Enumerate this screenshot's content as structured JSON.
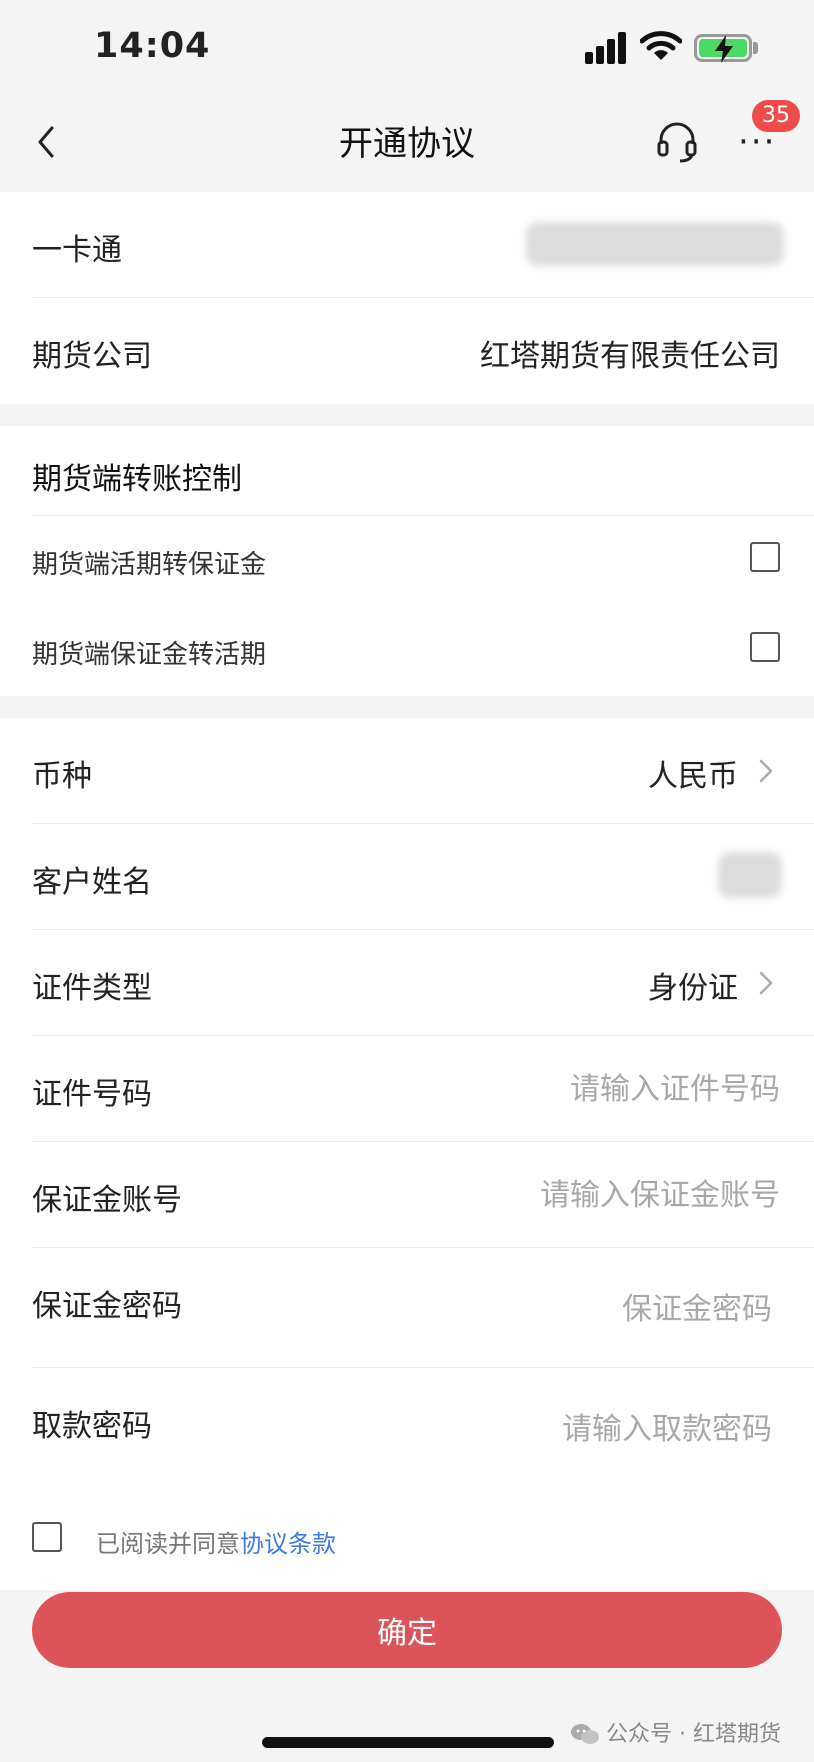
{
  "status_bar": {
    "time": "14:04"
  },
  "nav": {
    "title": "开通协议",
    "badge_count": "35",
    "icons": [
      "chevron-left-icon",
      "headset-icon",
      "more-icon"
    ]
  },
  "account": {
    "card_label": "一卡通",
    "company_label": "期货公司",
    "company_value": "红塔期货有限责任公司"
  },
  "transfer_control": {
    "title": "期货端转账控制",
    "options": [
      {
        "label": "期货端活期转保证金",
        "checked": false
      },
      {
        "label": "期货端保证金转活期",
        "checked": false
      }
    ]
  },
  "form": {
    "currency_label": "币种",
    "currency_value": "人民币",
    "name_label": "客户姓名",
    "id_type_label": "证件类型",
    "id_type_value": "身份证",
    "id_number_label": "证件号码",
    "id_number_placeholder": "请输入证件号码",
    "margin_account_label": "保证金账号",
    "margin_account_placeholder": "请输入保证金账号",
    "margin_password_label": "保证金密码",
    "margin_password_placeholder": "保证金密码",
    "withdraw_password_label": "取款密码",
    "withdraw_password_placeholder": "请输入取款密码"
  },
  "agreement": {
    "text": "已阅读并同意",
    "link": "协议条款",
    "checked": false
  },
  "confirm_label": "确定",
  "watermark": "公众号 · 红塔期货",
  "colors": {
    "accent": "#dc5459",
    "link": "#3d7be0",
    "badge": "#f04b4b",
    "battery": "#4cd964"
  }
}
